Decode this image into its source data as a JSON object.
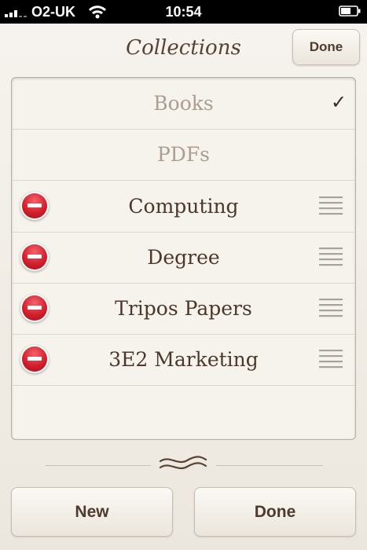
{
  "status_bar": {
    "carrier": "O2-UK",
    "time": "10:54",
    "signal_icon": "signal-bars-icon",
    "wifi_icon": "wifi-icon",
    "battery_icon": "battery-icon"
  },
  "header": {
    "title": "Collections",
    "done_label": "Done"
  },
  "collections": [
    {
      "label": "Books",
      "selected": true,
      "editable": false
    },
    {
      "label": "PDFs",
      "selected": false,
      "editable": false
    },
    {
      "label": "Computing",
      "selected": false,
      "editable": true
    },
    {
      "label": "Degree",
      "selected": false,
      "editable": true
    },
    {
      "label": "Tripos Papers",
      "selected": false,
      "editable": true
    },
    {
      "label": "3E2 Marketing",
      "selected": false,
      "editable": true
    }
  ],
  "check_mark": "✓",
  "footer": {
    "new_label": "New",
    "done_label": "Done"
  },
  "colors": {
    "accent_text": "#4e3b2e",
    "delete_red": "#d2202e",
    "background": "#efebe3"
  }
}
